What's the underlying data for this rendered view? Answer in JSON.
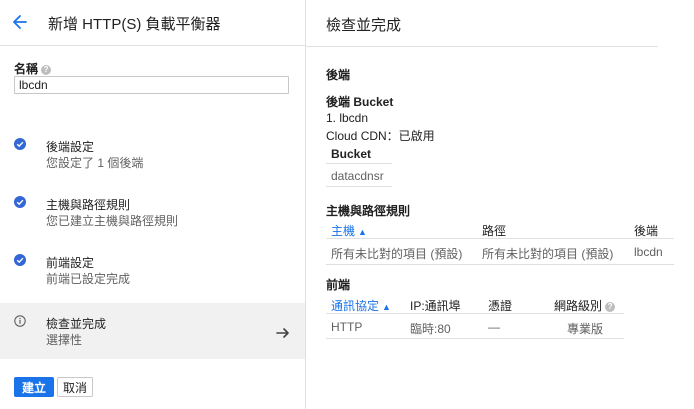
{
  "left": {
    "title": "新增 HTTP(S) 負載平衡器",
    "name_label": "名稱",
    "name_value": "lbcdn",
    "steps": [
      {
        "title": "後端設定",
        "subtitle": "您設定了 1 個後端"
      },
      {
        "title": "主機與路徑規則",
        "subtitle": "您已建立主機與路徑規則"
      },
      {
        "title": "前端設定",
        "subtitle": "前端已設定完成"
      },
      {
        "title": "檢查並完成",
        "subtitle": "選擇性"
      }
    ],
    "create_label": "建立",
    "cancel_label": "取消"
  },
  "right": {
    "title": "檢查並完成",
    "backend": {
      "heading": "後端",
      "bucket_heading": "後端 Bucket",
      "bucket_item": "1. lbcdn",
      "cdn_status": "Cloud CDN：已啟用",
      "table_header": "Bucket",
      "table_value": "datacdnsr"
    },
    "hostpath": {
      "heading": "主機與路徑規則",
      "columns": [
        "主機",
        "路徑",
        "後端"
      ],
      "row": [
        "所有未比對的項目 (預設)",
        "所有未比對的項目 (預設)",
        "lbcdn"
      ]
    },
    "frontend": {
      "heading": "前端",
      "columns": [
        "通訊協定",
        "IP:通訊埠",
        "憑證",
        "網路級別"
      ],
      "row": [
        "HTTP",
        "臨時:80",
        "—",
        "專業版"
      ]
    }
  },
  "colors": {
    "accent": "#1a73e8",
    "check": "#3367d6",
    "divider": "#e0e0e0"
  }
}
